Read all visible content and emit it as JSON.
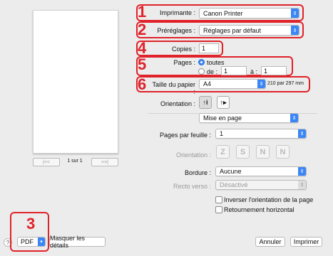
{
  "preview": {
    "page_count": "1 sur 1",
    "nav_first": "|<<",
    "nav_prev": "<",
    "nav_next": ">",
    "nav_last": ">>|"
  },
  "printer": {
    "label": "Imprimante :",
    "value": "Canon Printer"
  },
  "presets": {
    "label": "Préréglages :",
    "value": "Réglages par défaut"
  },
  "copies": {
    "label": "Copies :",
    "value": "1"
  },
  "pages": {
    "label": "Pages :",
    "all_label": "toutes",
    "from_label": "de :",
    "from_value": "1",
    "to_label": "à :",
    "to_value": "1",
    "selected": "all"
  },
  "paper_size": {
    "label": "Taille du papier :",
    "value": "A4",
    "dimensions": "210 par 297 mm"
  },
  "orientation": {
    "label": "Orientation :",
    "portrait_glyph": "↑i",
    "landscape_glyph": "↑▸"
  },
  "section": {
    "value": "Mise en page"
  },
  "pages_per_sheet": {
    "label": "Pages par feuille :",
    "value": "1"
  },
  "layout_direction": {
    "label": "Orientation :",
    "glyphs": [
      "Z",
      "S",
      "N",
      "N"
    ]
  },
  "border": {
    "label": "Bordure :",
    "value": "Aucune"
  },
  "two_sided": {
    "label": "Recto verso :",
    "value": "Désactivé"
  },
  "reverse_orientation": {
    "label": "Inverser l'orientation de la page",
    "checked": false
  },
  "flip_horizontal": {
    "label": "Retournement horizontal",
    "checked": false
  },
  "bottom": {
    "help": "?",
    "pdf": "PDF",
    "hide_details": "Masquer les détails",
    "cancel": "Annuler",
    "print": "Imprimer"
  },
  "annotations": {
    "n1": "1",
    "n2": "2",
    "n3": "3",
    "n4": "4",
    "n5": "5",
    "n6": "6"
  },
  "colors": {
    "accent": "#3b86f7",
    "annotation": "#e0222a"
  }
}
